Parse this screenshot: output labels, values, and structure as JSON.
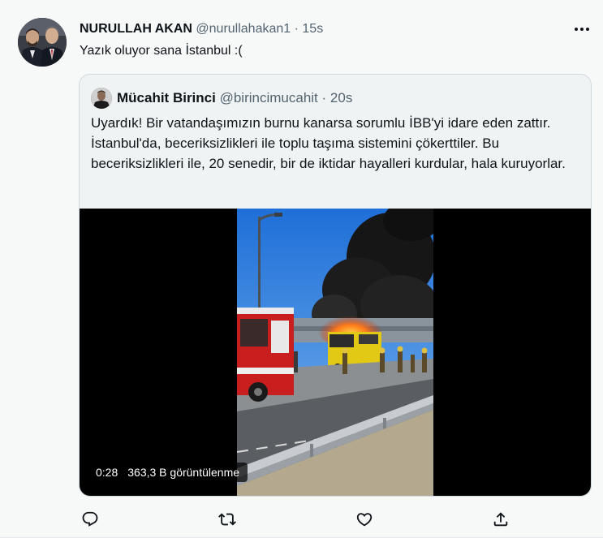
{
  "tweet": {
    "author": {
      "display_name": "NURULLAH AKAN",
      "handle": "@nurullahakan1",
      "separator": "·",
      "time": "15s"
    },
    "text": "Yazık oluyor sana İstanbul :("
  },
  "quote": {
    "author": {
      "display_name": "Mücahit Birinci",
      "handle": "@birincimucahit",
      "separator": "·",
      "time": "20s"
    },
    "text": "Uyardık! Bir vatandaşımızın burnu kanarsa sorumlu İBB'yi idare eden zattır. İstanbul'da, beceriksizlikleri ile toplu taşıma sistemini çökerttiler. Bu beceriksizlikleri ile, 20 senedir, bir de iktidar hayalleri kurdular, hala kuruyorlar.",
    "media": {
      "duration": "0:28",
      "views": "363,3 B görüntülenme"
    }
  },
  "actions": {
    "reply_icon": "reply-icon",
    "retweet_icon": "retweet-icon",
    "like_icon": "heart-icon",
    "share_icon": "share-icon"
  },
  "colors": {
    "primary_text": "#0f1419",
    "secondary_text": "#536471",
    "background": "#f7f9f9",
    "border": "#cfd9de"
  }
}
